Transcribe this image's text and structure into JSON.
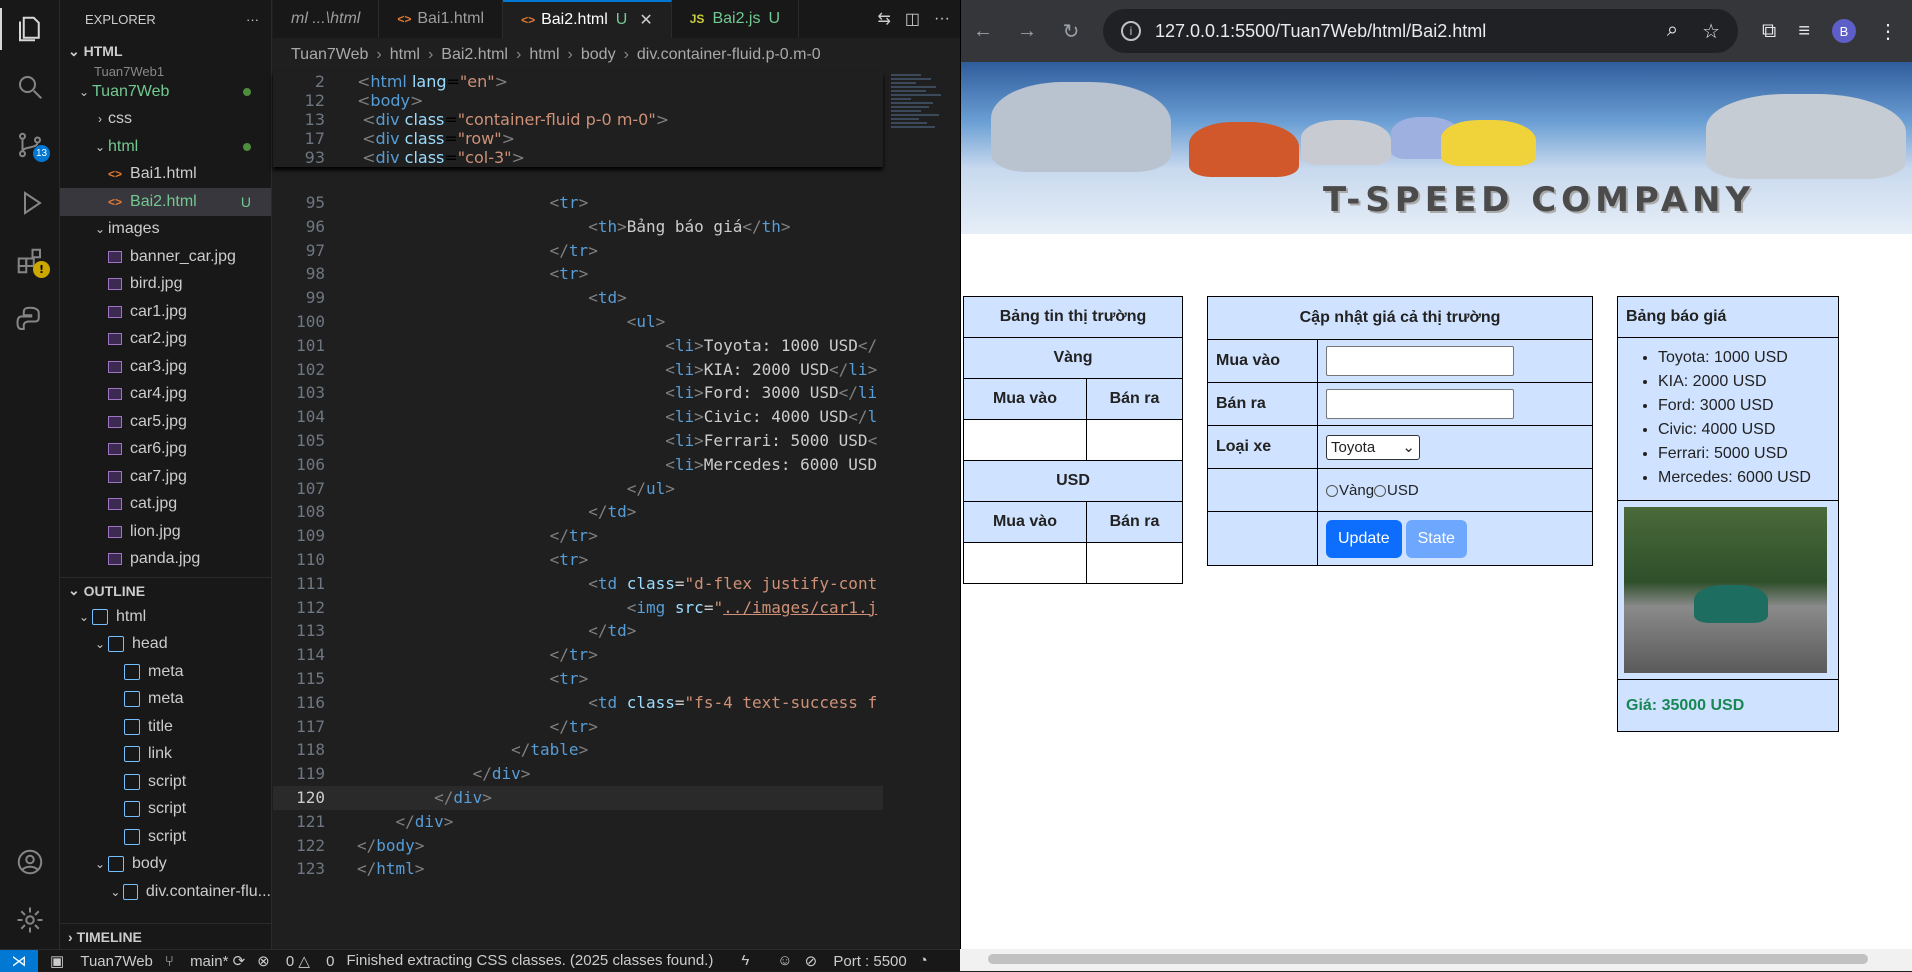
{
  "activity": {
    "scm_badge": "13"
  },
  "explorer": {
    "title": "EXPLORER",
    "section": "HTML",
    "partial": "Tuan7Web1",
    "items": [
      {
        "label": "Tuan7Web",
        "type": "folder",
        "indent": 1,
        "status": "dot"
      },
      {
        "label": "css",
        "type": "folder-closed",
        "indent": 2
      },
      {
        "label": "html",
        "type": "folder",
        "indent": 2,
        "status": "dot"
      },
      {
        "label": "Bai1.html",
        "type": "html",
        "indent": 3
      },
      {
        "label": "Bai2.html",
        "type": "html",
        "indent": 3,
        "status": "U",
        "selected": true
      },
      {
        "label": "images",
        "type": "folder",
        "indent": 2
      },
      {
        "label": "banner_car.jpg",
        "type": "img",
        "indent": 3
      },
      {
        "label": "bird.jpg",
        "type": "img",
        "indent": 3
      },
      {
        "label": "car1.jpg",
        "type": "img",
        "indent": 3
      },
      {
        "label": "car2.jpg",
        "type": "img",
        "indent": 3
      },
      {
        "label": "car3.jpg",
        "type": "img",
        "indent": 3
      },
      {
        "label": "car4.jpg",
        "type": "img",
        "indent": 3
      },
      {
        "label": "car5.jpg",
        "type": "img",
        "indent": 3
      },
      {
        "label": "car6.jpg",
        "type": "img",
        "indent": 3
      },
      {
        "label": "car7.jpg",
        "type": "img",
        "indent": 3
      },
      {
        "label": "cat.jpg",
        "type": "img",
        "indent": 3
      },
      {
        "label": "lion.jpg",
        "type": "img",
        "indent": 3
      },
      {
        "label": "panda.jpg",
        "type": "img",
        "indent": 3
      }
    ]
  },
  "outline": {
    "title": "OUTLINE",
    "items": [
      {
        "label": "html",
        "indent": 1,
        "caret": true
      },
      {
        "label": "head",
        "indent": 2,
        "caret": true
      },
      {
        "label": "meta",
        "indent": 3
      },
      {
        "label": "meta",
        "indent": 3
      },
      {
        "label": "title",
        "indent": 3
      },
      {
        "label": "link",
        "indent": 3
      },
      {
        "label": "script",
        "indent": 3
      },
      {
        "label": "script",
        "indent": 3
      },
      {
        "label": "script",
        "indent": 3
      },
      {
        "label": "body",
        "indent": 2,
        "caret": true
      },
      {
        "label": "div.container-flu...",
        "indent": 3,
        "caret": true
      }
    ]
  },
  "timeline": "TIMELINE",
  "tabs": [
    {
      "label": "ml ...\\html",
      "kind": "partial"
    },
    {
      "label": "Bai1.html",
      "kind": "html"
    },
    {
      "label": "Bai2.html",
      "kind": "html",
      "status": "U",
      "active": true
    },
    {
      "label": "Bai2.js",
      "kind": "js",
      "status": "U"
    }
  ],
  "breadcrumb": [
    "Tuan7Web",
    "html",
    "Bai2.html",
    "html",
    "body",
    "div.container-fluid.p-0.m-0"
  ],
  "sticky": [
    {
      "n": "2",
      "html": "<span class='p'>&lt;</span><span class='t'>html</span> <span class='a'>lang</span>=<span class='s'>\"en\"</span><span class='p'>&gt;</span>",
      "i": 0
    },
    {
      "n": "12",
      "html": "<span class='p'>&lt;</span><span class='t'>body</span><span class='p'>&gt;</span>",
      "i": 0
    },
    {
      "n": "13",
      "html": "<span class='p'>&lt;</span><span class='t'>div</span> <span class='a'>class</span>=<span class='s'>\"container-fluid p-0 m-0\"</span><span class='p'>&gt;</span>",
      "i": 1
    },
    {
      "n": "17",
      "html": "<span class='p'>&lt;</span><span class='t'>div</span> <span class='a'>class</span>=<span class='s'>\"row\"</span><span class='p'>&gt;</span>",
      "i": 2
    },
    {
      "n": "93",
      "html": "<span class='p'>&lt;</span><span class='t'>div</span> <span class='a'>class</span>=<span class='s'>\"col-3\"</span><span class='p'>&gt;</span>",
      "i": 3
    }
  ],
  "code": [
    {
      "n": "95",
      "html": "<span class='p'>&lt;</span><span class='t'>tr</span><span class='p'>&gt;</span>",
      "i": 5
    },
    {
      "n": "96",
      "html": "<span class='p'>&lt;</span><span class='t'>th</span><span class='p'>&gt;</span><span class='tx'>Bảng báo giá</span><span class='p'>&lt;/</span><span class='t'>th</span><span class='p'>&gt;</span>",
      "i": 6
    },
    {
      "n": "97",
      "html": "<span class='p'>&lt;/</span><span class='t'>tr</span><span class='p'>&gt;</span>",
      "i": 5
    },
    {
      "n": "98",
      "html": "<span class='p'>&lt;</span><span class='t'>tr</span><span class='p'>&gt;</span>",
      "i": 5
    },
    {
      "n": "99",
      "html": "<span class='p'>&lt;</span><span class='t'>td</span><span class='p'>&gt;</span>",
      "i": 6
    },
    {
      "n": "100",
      "html": "<span class='p'>&lt;</span><span class='t'>ul</span><span class='p'>&gt;</span>",
      "i": 7
    },
    {
      "n": "101",
      "html": "<span class='p'>&lt;</span><span class='t'>li</span><span class='p'>&gt;</span><span class='tx'>Toyota: 1000 USD</span><span class='p'>&lt;/</span>",
      "i": 8
    },
    {
      "n": "102",
      "html": "<span class='p'>&lt;</span><span class='t'>li</span><span class='p'>&gt;</span><span class='tx'>KIA: 2000 USD</span><span class='p'>&lt;/</span><span class='t'>li</span><span class='p'>&gt;</span>",
      "i": 8
    },
    {
      "n": "103",
      "html": "<span class='p'>&lt;</span><span class='t'>li</span><span class='p'>&gt;</span><span class='tx'>Ford: 3000 USD</span><span class='p'>&lt;/</span><span class='t'>li</span>",
      "i": 8
    },
    {
      "n": "104",
      "html": "<span class='p'>&lt;</span><span class='t'>li</span><span class='p'>&gt;</span><span class='tx'>Civic: 4000 USD</span><span class='p'>&lt;/</span><span class='t'>l</span>",
      "i": 8
    },
    {
      "n": "105",
      "html": "<span class='p'>&lt;</span><span class='t'>li</span><span class='p'>&gt;</span><span class='tx'>Ferrari: 5000 USD</span><span class='p'>&lt;</span>",
      "i": 8
    },
    {
      "n": "106",
      "html": "<span class='p'>&lt;</span><span class='t'>li</span><span class='p'>&gt;</span><span class='tx'>Mercedes: 6000 USD</span>",
      "i": 8
    },
    {
      "n": "107",
      "html": "<span class='p'>&lt;/</span><span class='t'>ul</span><span class='p'>&gt;</span>",
      "i": 7
    },
    {
      "n": "108",
      "html": "<span class='p'>&lt;/</span><span class='t'>td</span><span class='p'>&gt;</span>",
      "i": 6
    },
    {
      "n": "109",
      "html": "<span class='p'>&lt;/</span><span class='t'>tr</span><span class='p'>&gt;</span>",
      "i": 5
    },
    {
      "n": "110",
      "html": "<span class='p'>&lt;</span><span class='t'>tr</span><span class='p'>&gt;</span>",
      "i": 5
    },
    {
      "n": "111",
      "html": "<span class='p'>&lt;</span><span class='t'>td</span> <span class='a'>class</span>=<span class='s'>\"d-flex justify-cont</span>",
      "i": 6
    },
    {
      "n": "112",
      "html": "<span class='p'>&lt;</span><span class='t'>img</span> <span class='a'>src</span>=<span class='s'>\"<u>../images/car1.j</u></span>",
      "i": 7
    },
    {
      "n": "113",
      "html": "<span class='p'>&lt;/</span><span class='t'>td</span><span class='p'>&gt;</span>",
      "i": 6
    },
    {
      "n": "114",
      "html": "<span class='p'>&lt;/</span><span class='t'>tr</span><span class='p'>&gt;</span>",
      "i": 5
    },
    {
      "n": "115",
      "html": "<span class='p'>&lt;</span><span class='t'>tr</span><span class='p'>&gt;</span>",
      "i": 5
    },
    {
      "n": "116",
      "html": "<span class='p'>&lt;</span><span class='t'>td</span> <span class='a'>class</span>=<span class='s'>\"fs-4 text-success f</span>",
      "i": 6
    },
    {
      "n": "117",
      "html": "<span class='p'>&lt;/</span><span class='t'>tr</span><span class='p'>&gt;</span>",
      "i": 5
    },
    {
      "n": "118",
      "html": "<span class='p'>&lt;/</span><span class='t'>table</span><span class='p'>&gt;</span>",
      "i": 4
    },
    {
      "n": "119",
      "html": "<span class='p'>&lt;/</span><span class='t'>div</span><span class='p'>&gt;</span>",
      "i": 3
    },
    {
      "n": "120",
      "html": "<span class='p'>&lt;/</span><span class='t'>div</span><span class='p'>&gt;</span>",
      "i": 2,
      "cur": true
    },
    {
      "n": "121",
      "html": "<span class='p'>&lt;/</span><span class='t'>div</span><span class='p'>&gt;</span>",
      "i": 1
    },
    {
      "n": "122",
      "html": "<span class='p'>&lt;/</span><span class='t'>body</span><span class='p'>&gt;</span>",
      "i": 0
    },
    {
      "n": "123",
      "html": "<span class='p'>&lt;/</span><span class='t'>html</span><span class='p'>&gt;</span>",
      "i": 0
    }
  ],
  "browser": {
    "url": "127.0.0.1:5500/Tuan7Web/html/Bai2.html",
    "avatar": "B"
  },
  "page": {
    "company": "T-SPEED COMPANY",
    "market": {
      "title": "Bảng tin thị trường",
      "gold": "Vàng",
      "usd": "USD",
      "buy": "Mua vào",
      "sell": "Bán ra"
    },
    "update": {
      "title": "Cập nhật giá cả thị trường",
      "buy": "Mua vào",
      "sell": "Bán ra",
      "type": "Loại xe",
      "selected": "Toyota",
      "opt_gold": "Vàng",
      "opt_usd": "USD",
      "btn_update": "Update",
      "btn_state": "State"
    },
    "pricelist": {
      "title": "Bảng báo giá",
      "items": [
        "Toyota: 1000 USD",
        "KIA: 2000 USD",
        "Ford: 3000 USD",
        "Civic: 4000 USD",
        "Ferrari: 5000 USD",
        "Mercedes: 6000 USD"
      ],
      "price": "Giá: 35000 USD"
    }
  },
  "statusbar": {
    "project": "Tuan7Web",
    "branch": "main*",
    "errors": "0",
    "warnings": "0",
    "message": "Finished extracting CSS classes. (2025 classes found.)",
    "port": "Port : 5500"
  }
}
